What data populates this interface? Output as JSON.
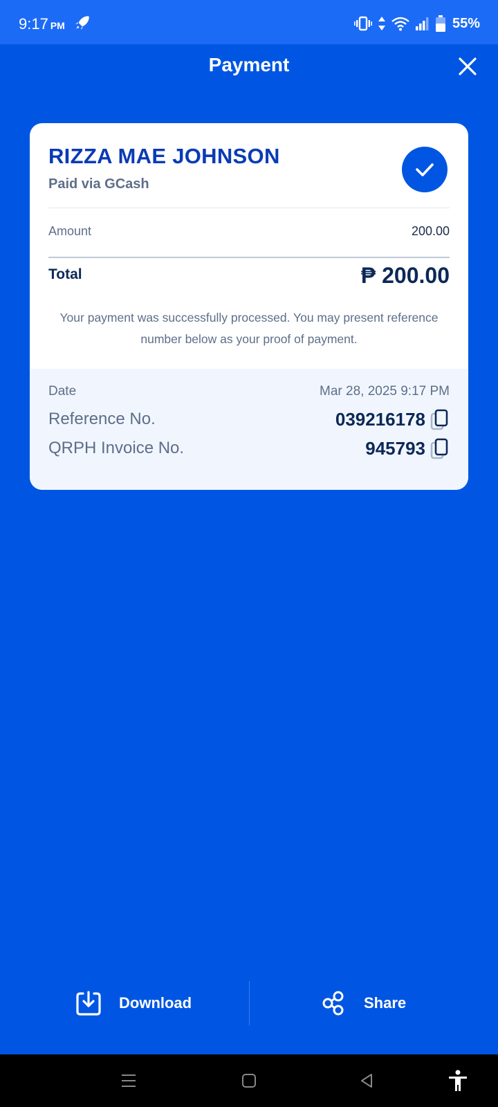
{
  "status_bar": {
    "time": "9:17",
    "ampm": "PM",
    "battery": "55%"
  },
  "header": {
    "title": "Payment"
  },
  "receipt": {
    "payee_name": "RIZZA MAE JOHNSON",
    "paid_via": "Paid via GCash",
    "amount_label": "Amount",
    "amount_value": "200.00",
    "total_label": "Total",
    "total_value": "₱ 200.00",
    "message": "Your payment was successfully processed. You may present reference number below as your proof of payment.",
    "date_label": "Date",
    "date_value": "Mar 28, 2025 9:17 PM",
    "reference_label": "Reference No.",
    "reference_value": "039216178",
    "invoice_label": "QRPH Invoice No.",
    "invoice_value": "945793"
  },
  "actions": {
    "download_label": "Download",
    "share_label": "Share"
  },
  "colors": {
    "background": "#0056E2",
    "status_bar": "#1C6BF6",
    "payee_name": "#0A3BB5",
    "details_bg": "#F1F6FE"
  }
}
